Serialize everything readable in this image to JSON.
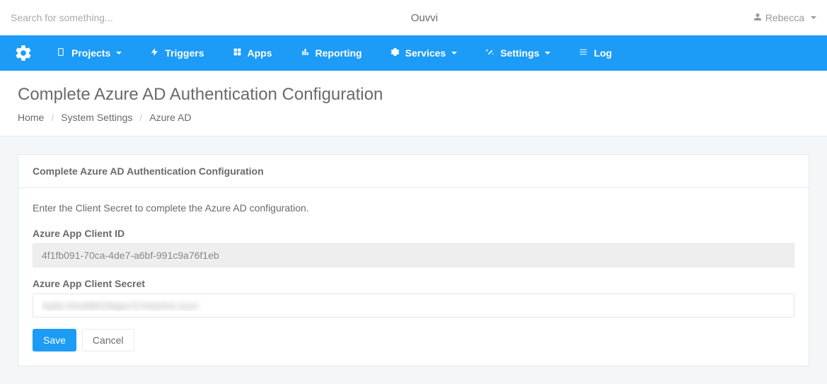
{
  "topbar": {
    "search_placeholder": "Search for something...",
    "brand": "Ouvvi",
    "user_name": "Rebecca"
  },
  "nav": {
    "items": [
      {
        "label": "Projects",
        "icon": "book",
        "dropdown": true
      },
      {
        "label": "Triggers",
        "icon": "bolt",
        "dropdown": false
      },
      {
        "label": "Apps",
        "icon": "grid",
        "dropdown": false
      },
      {
        "label": "Reporting",
        "icon": "chart",
        "dropdown": false
      },
      {
        "label": "Services",
        "icon": "gear",
        "dropdown": true
      },
      {
        "label": "Settings",
        "icon": "wand",
        "dropdown": true
      },
      {
        "label": "Log",
        "icon": "list",
        "dropdown": false
      }
    ]
  },
  "page": {
    "title": "Complete Azure AD Authentication Configuration",
    "breadcrumb": {
      "home": "Home",
      "settings": "System Settings",
      "current": "Azure AD"
    }
  },
  "panel": {
    "heading": "Complete Azure AD Authentication Configuration",
    "help": "Enter the Client Secret to complete the Azure AD configuration.",
    "client_id_label": "Azure App Client ID",
    "client_id_value": "4f1fb091-70ca-4de7-a6bf-991c9a76f1eb",
    "client_secret_label": "Azure App Client Secret",
    "client_secret_value": "hqdv.r4mddkt19iqpcrCmtrpAnLxyux",
    "save_label": "Save",
    "cancel_label": "Cancel"
  }
}
